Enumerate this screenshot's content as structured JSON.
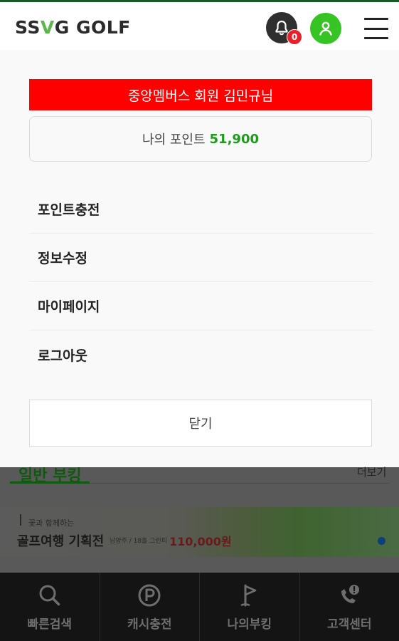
{
  "header": {
    "logo_left": "SS",
    "logo_v": "V",
    "logo_right": "G GOLF",
    "notification_count": "0",
    "icons": [
      "bell-icon",
      "user-icon",
      "hamburger-menu-icon"
    ],
    "accent_colors": {
      "logo_v": "#5bb84a",
      "user": "#35c424",
      "badge": "#e8202a",
      "topline": "#1a5a2a"
    }
  },
  "panel": {
    "member_banner": "중앙멤버스 회원 김민규님",
    "points_label": "나의 포인트",
    "points_value": "51,900",
    "menu_items": [
      {
        "label": "포인트충전"
      },
      {
        "label": "정보수정"
      },
      {
        "label": "마이페이지"
      },
      {
        "label": "로그아웃"
      }
    ],
    "close_label": "닫기",
    "colors": {
      "banner": "#ff0000",
      "points_value": "#1f9a1f"
    }
  },
  "underlying": {
    "section_title": "일반 부킹",
    "more_label": "더보기",
    "banner_sub": "꽃과 함께하는",
    "banner_main": "골프여행 기획전",
    "banner_info": "남양주 / 18홀 그린피",
    "banner_price": "110,000원"
  },
  "bottom_nav": [
    {
      "label": "빠른검색",
      "icon": "search-icon"
    },
    {
      "label": "캐시충전",
      "icon": "coin-p-icon"
    },
    {
      "label": "나의부킹",
      "icon": "golf-flag-icon"
    },
    {
      "label": "고객센터",
      "icon": "phone-support-icon"
    }
  ]
}
